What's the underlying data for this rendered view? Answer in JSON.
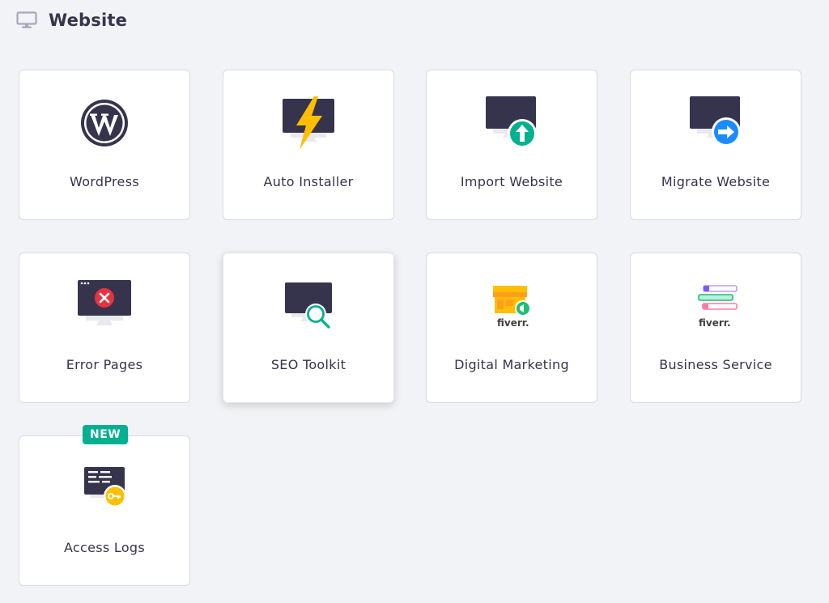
{
  "header": {
    "title": "Website",
    "icon": "monitor-icon"
  },
  "cards": [
    {
      "label": "WordPress",
      "icon": "wordpress-icon"
    },
    {
      "label": "Auto Installer",
      "icon": "auto-installer-icon"
    },
    {
      "label": "Import Website",
      "icon": "import-website-icon"
    },
    {
      "label": "Migrate Website",
      "icon": "migrate-website-icon"
    },
    {
      "label": "Error Pages",
      "icon": "error-pages-icon"
    },
    {
      "label": "SEO Toolkit",
      "icon": "seo-toolkit-icon"
    },
    {
      "label": "Digital Marketing",
      "icon": "fiverr-marketing-icon",
      "logo_text": "fiverr."
    },
    {
      "label": "Business Service",
      "icon": "fiverr-business-icon",
      "logo_text": "fiverr."
    },
    {
      "label": "Access Logs",
      "icon": "access-logs-icon",
      "badge": "NEW"
    }
  ],
  "colors": {
    "background": "#f2f3f6",
    "monitor": "#36344d",
    "green": "#00b090",
    "blue": "#1a8cff",
    "red": "#e5333f",
    "yellow": "#ffbf00",
    "fiverr_green": "#1dbf73"
  }
}
